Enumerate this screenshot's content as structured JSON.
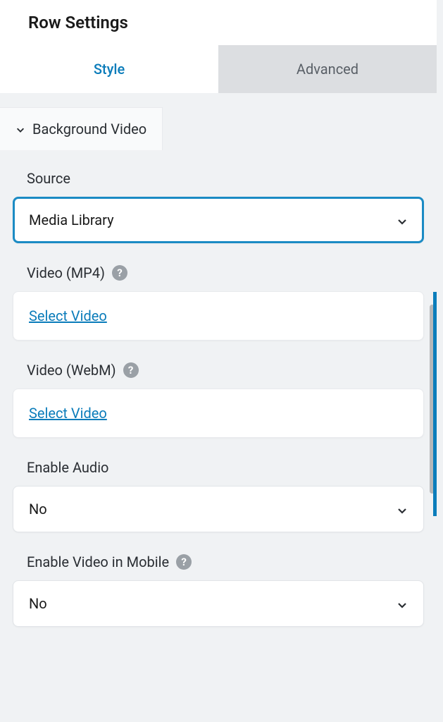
{
  "header": {
    "title": "Row Settings"
  },
  "tabs": {
    "style": "Style",
    "advanced": "Advanced",
    "active": "style"
  },
  "section": {
    "title": "Background Video"
  },
  "fields": {
    "source": {
      "label": "Source",
      "value": "Media Library"
    },
    "video_mp4": {
      "label": "Video (MP4)",
      "action": "Select Video"
    },
    "video_webm": {
      "label": "Video (WebM)",
      "action": "Select Video"
    },
    "enable_audio": {
      "label": "Enable Audio",
      "value": "No"
    },
    "enable_video_mobile": {
      "label": "Enable Video in Mobile",
      "value": "No"
    }
  }
}
